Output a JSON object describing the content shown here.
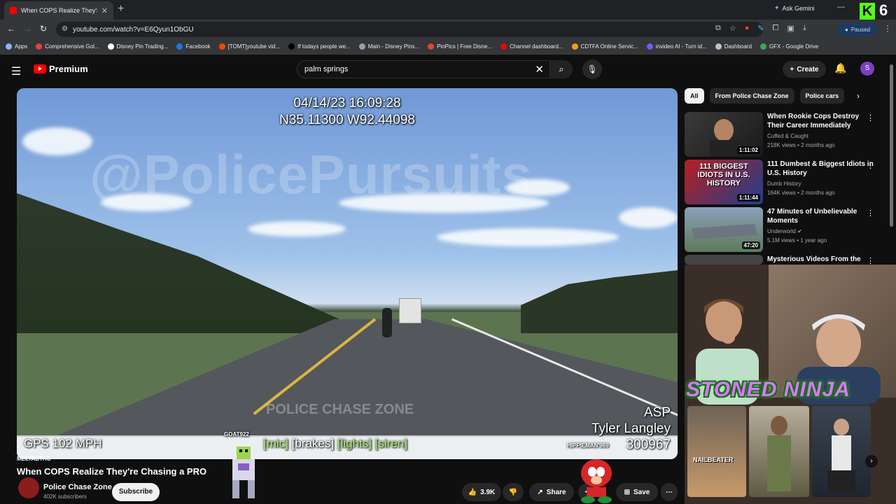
{
  "browser": {
    "tab_title": "When COPS Realize They're Ch",
    "new_tab": "+",
    "ask_gemini": "Ask Gemini",
    "url": "youtube.com/watch?v=E6Qyun1ObGU",
    "profile_status": "Paused",
    "kick_badge": "6",
    "bookmarks": [
      {
        "label": "Apps",
        "color": "#8ab4f8"
      },
      {
        "label": "Comprehensive Gol...",
        "color": "#e94235"
      },
      {
        "label": "Disney Pin Trading...",
        "color": "#ffffff"
      },
      {
        "label": "Facebook",
        "color": "#1877f2"
      },
      {
        "label": "[TOMT]youtube vid...",
        "color": "#ff4500"
      },
      {
        "label": "If todays people we...",
        "color": "#000000"
      },
      {
        "label": "Main - Disney Pins...",
        "color": "#9aa0a6"
      },
      {
        "label": "PinPics | Free Disne...",
        "color": "#e94235"
      },
      {
        "label": "Channel dashboard...",
        "color": "#ff0000"
      },
      {
        "label": "CDTFA Online Servic...",
        "color": "#f59e0b"
      },
      {
        "label": "invideo AI - Turn id...",
        "color": "#6d5dfc"
      },
      {
        "label": "Dashboard",
        "color": "#bdc1c6"
      },
      {
        "label": "GFX - Google Drive",
        "color": "#34a853"
      }
    ]
  },
  "youtube": {
    "brand": "Premium",
    "search_value": "palm springs",
    "create_label": "Create",
    "avatar_letter": "S"
  },
  "video": {
    "timestamp": "04/14/23 16:09:28",
    "coords": "N35.11300 W92.44098",
    "watermark": "@PolicePursuits",
    "zone_watermark": "POLICE CHASE ZONE",
    "gps": "GPS 102 MPH",
    "mics": {
      "open": "[mic] ",
      "brakes": "[brakes] ",
      "lights": "[lights] ",
      "siren": "[siren]"
    },
    "agency": "ASP",
    "officer": "Tyler Langley",
    "badge": "300967",
    "tag_goat": "GOAT922",
    "tag_hippie": "HIPPIEMAN'969",
    "title": "When COPS Realize They're Chasing a PRO",
    "tag_melt": "MELTABTHC",
    "channel": "Police Chase Zone",
    "subscribers": "402K subscribers",
    "subscribe_label": "Subscribe",
    "likes": "3.9K",
    "share_label": "Share",
    "save_label": "Save"
  },
  "sidebar": {
    "chips": [
      "All",
      "From Police Chase Zone",
      "Police cars"
    ],
    "recs": [
      {
        "title": "When Rookie Cops Destroy Their Career Immediately",
        "channel": "Cuffed & Caught",
        "meta": "218K views • 2 months ago",
        "duration": "1:11:02"
      },
      {
        "title": "111 Dumbest & Biggest Idiots in U.S. History",
        "channel": "Dumb History",
        "meta": "164K views • 2 months ago",
        "duration": "1:11:44",
        "thumb_text": "111 BIGGEST IDIOTS IN U.S. HISTORY"
      },
      {
        "title": "47 Minutes of Unbelievable Moments",
        "channel": "Underworld",
        "meta": "5.1M views • 1 year ago",
        "duration": "47:20"
      },
      {
        "title": "Mysterious Videos From the"
      }
    ]
  },
  "overlay": {
    "stoned_ninja": "STONED NINJA",
    "nailbeater": "NAILBEATER"
  }
}
